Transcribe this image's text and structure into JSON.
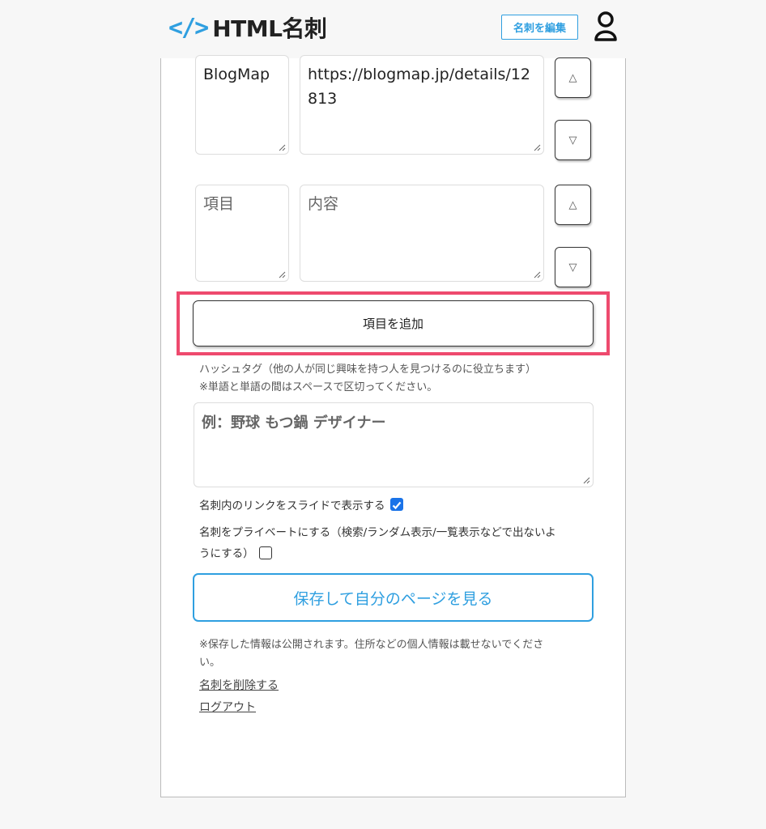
{
  "header": {
    "logo_mark": "</>",
    "logo_text": "HTML名刺",
    "edit_button": "名刺を編集"
  },
  "items": [
    {
      "label": "BlogMap",
      "content": "https://blogmap.jp/details/12813",
      "up": "△",
      "down": "▽"
    },
    {
      "label_placeholder": "項目",
      "content_placeholder": "内容",
      "up": "△",
      "down": "▽"
    }
  ],
  "add_item_button": "項目を追加",
  "hashtag": {
    "note_line1": "ハッシュタグ（他の人が同じ興味を持つ人を見つけるのに役立ちます）",
    "note_line2": "※単語と単語の間はスペースで区切ってください。",
    "placeholder": "例：野球 もつ鍋 デザイナー"
  },
  "options": {
    "slide_label": "名刺内のリンクをスライドで表示する",
    "slide_checked": true,
    "private_label_line1": "名刺をプライベートにする（検索/ランダム表示/一覧表示などで出ないよ",
    "private_label_line2": "うにする）",
    "private_checked": false
  },
  "save_button": "保存して自分のページを見る",
  "disclaimer_line1": "※保存した情報は公開されます。住所などの個人情報は載せないでくださ",
  "disclaimer_line2": "い。",
  "links": {
    "delete": "名刺を削除する",
    "logout": "ログアウト"
  },
  "colors": {
    "accent": "#2f9fe0",
    "highlight": "#ee4a6e",
    "checkbox": "#1a73e8"
  }
}
